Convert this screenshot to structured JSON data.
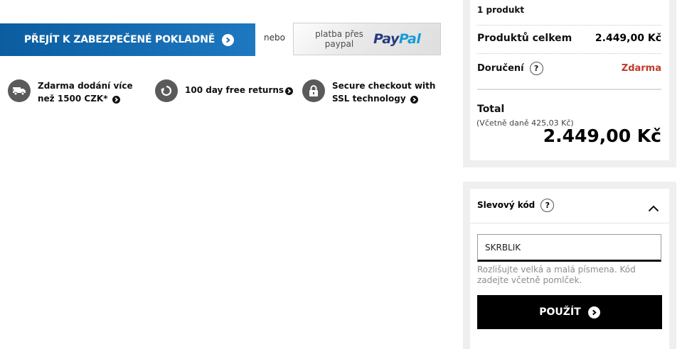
{
  "checkout": {
    "secure_checkout_label": "PŘEJÍT K ZABEZPEČENÉ POKLADNĚ",
    "or_label": "nebo",
    "paypal_small_text_line1": "platba přes",
    "paypal_small_text_line2": "paypal",
    "paypal_logo_part1": "Pay",
    "paypal_logo_part2": "Pal",
    "paypal_colors": {
      "dark": "#253b80",
      "light": "#179bd7"
    },
    "button_color": "#1e6fb0"
  },
  "benefits": [
    {
      "icon": "truck-icon",
      "line1": "Zdarma dodání více",
      "line2": "než 1500 CZK*"
    },
    {
      "icon": "return-icon",
      "line1": "100 day free returns",
      "line2": ""
    },
    {
      "icon": "lock-icon",
      "line1": "Secure checkout with",
      "line2": "SSL technology"
    }
  ],
  "summary": {
    "product_count": "1 produkt",
    "products_total_label": "Produktů celkem",
    "products_total_value": "2.449,00 Kč",
    "delivery_label": "Doručení",
    "delivery_value": "Zdarma",
    "delivery_value_color": "#c0392b",
    "help_label": "?",
    "total_label": "Total",
    "vat_note": "(Včetně daně 425,03 Kč)",
    "total_value": "2.449,00 Kč"
  },
  "discount": {
    "title": "Slevový kód",
    "help_label": "?",
    "input_value": "SKRBLIK",
    "hint": "Rozlišujte velká a malá písmena. Kód zadejte včetně pomlček.",
    "apply_label": "POUŽÍT"
  }
}
